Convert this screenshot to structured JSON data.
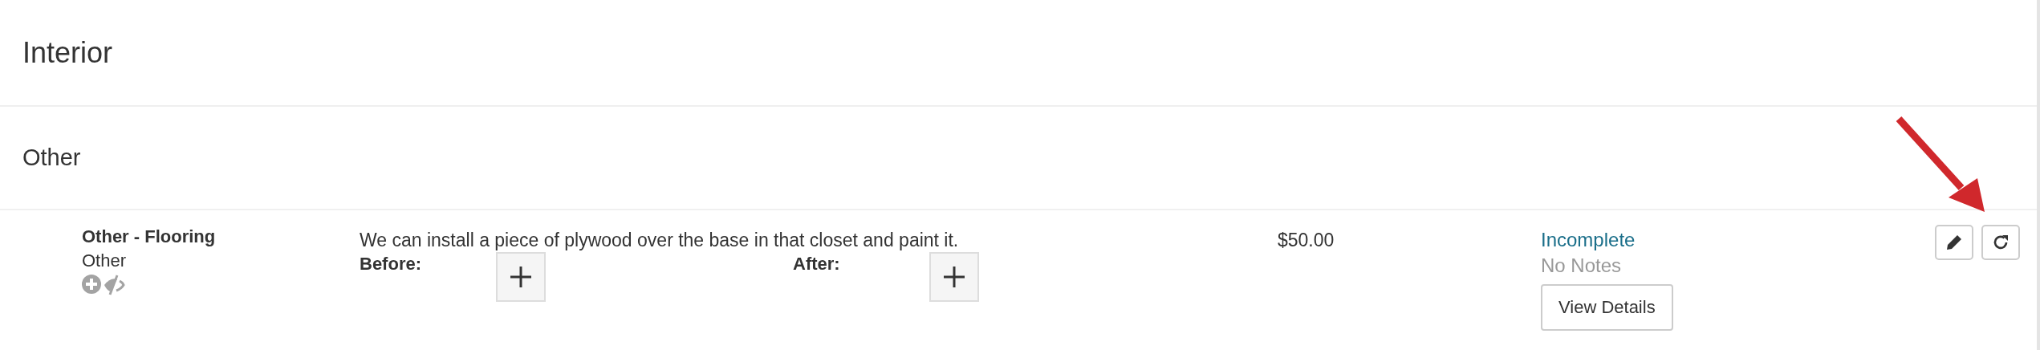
{
  "section": {
    "title": "Interior"
  },
  "group": {
    "title": "Other"
  },
  "items": [
    {
      "name": "Other - Flooring",
      "category": "Other",
      "description": "We can install a piece of plywood over the base in that closet and paint it.",
      "photos": [
        {
          "label": "Before:"
        },
        {
          "label": "After:"
        }
      ],
      "price": "$50.00",
      "status": "Incomplete",
      "notes": "No Notes",
      "details_button": "View Details"
    }
  ],
  "annotation": {
    "kind": "arrow"
  }
}
